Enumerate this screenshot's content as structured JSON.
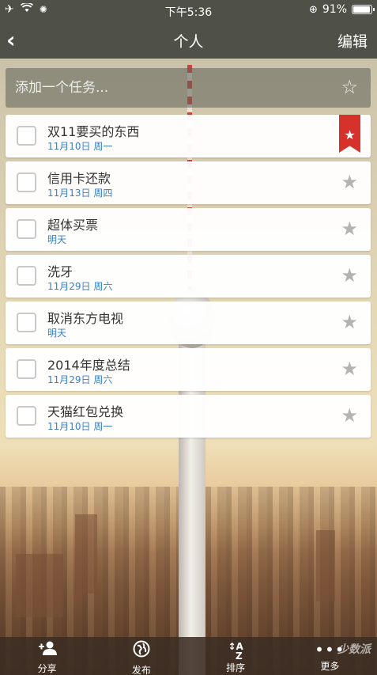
{
  "status_bar": {
    "time": "下午5:36",
    "battery": "91%"
  },
  "nav": {
    "title": "个人",
    "edit": "编辑"
  },
  "add_task": {
    "placeholder": "添加一个任务..."
  },
  "tasks": [
    {
      "title": "双11要买的东西",
      "date": "11月10日 周一",
      "starred": true
    },
    {
      "title": "信用卡还款",
      "date": "11月13日 周四",
      "starred": false
    },
    {
      "title": "超体买票",
      "date": "明天",
      "starred": false
    },
    {
      "title": "洗牙",
      "date": "11月29日 周六",
      "starred": false
    },
    {
      "title": "取消东方电视",
      "date": "明天",
      "starred": false
    },
    {
      "title": "2014年度总结",
      "date": "11月29日 周六",
      "starred": false
    },
    {
      "title": "天猫红包兑换",
      "date": "11月10日 周一",
      "starred": false
    }
  ],
  "toolbar": {
    "share": "分享",
    "publish": "发布",
    "sort": "排序",
    "more": "更多"
  },
  "watermark": "少数派",
  "colors": {
    "bar": "#4f5148",
    "date_blue": "#3b7fc4",
    "flag_red": "#d6322b"
  }
}
